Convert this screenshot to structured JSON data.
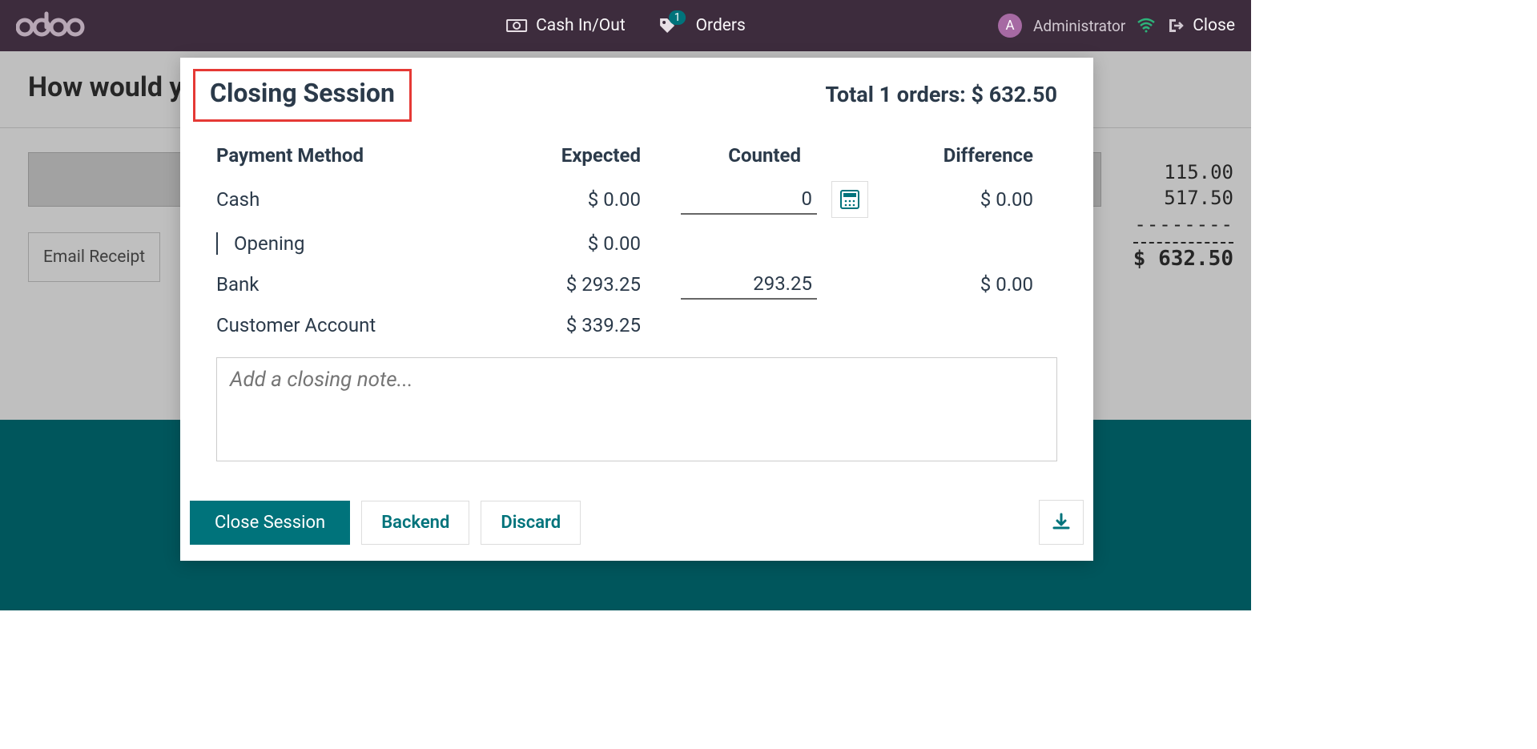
{
  "header": {
    "cash_in_out": "Cash In/Out",
    "orders": "Orders",
    "orders_badge": "1",
    "user_initial": "A",
    "user_name": "Administrator",
    "close": "Close"
  },
  "bg": {
    "heading": "How would y",
    "email_receipt": "Email Receipt",
    "line1": "115.00",
    "line2": "517.50",
    "total": "$ 632.50"
  },
  "modal": {
    "title": "Closing Session",
    "total_text": "Total 1 orders: $ 632.50",
    "columns": {
      "method": "Payment Method",
      "expected": "Expected",
      "counted": "Counted",
      "difference": "Difference"
    },
    "rows": {
      "cash": {
        "name": "Cash",
        "expected": "$ 0.00",
        "counted": "0",
        "difference": "$ 0.00"
      },
      "opening": {
        "name": "Opening",
        "expected": "$ 0.00"
      },
      "bank": {
        "name": "Bank",
        "expected": "$ 293.25",
        "counted": "293.25",
        "difference": "$ 0.00"
      },
      "customer": {
        "name": "Customer Account",
        "expected": "$ 339.25"
      }
    },
    "note_placeholder": "Add a closing note...",
    "buttons": {
      "close_session": "Close Session",
      "backend": "Backend",
      "discard": "Discard"
    }
  }
}
